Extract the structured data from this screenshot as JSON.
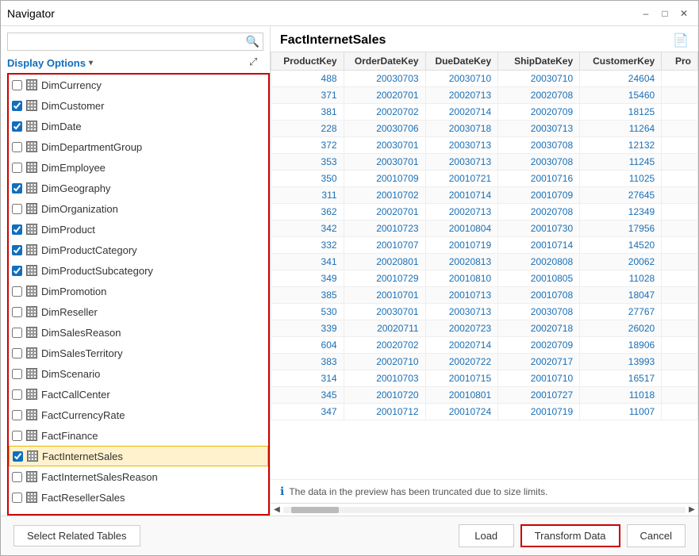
{
  "window": {
    "title": "Navigator",
    "minimize_label": "–",
    "maximize_label": "□",
    "close_label": "✕"
  },
  "left_panel": {
    "search_placeholder": "",
    "display_options_label": "Display Options",
    "display_options_arrow": "▾",
    "expand_label": "⤢",
    "tables": [
      {
        "id": "DimCurrency",
        "name": "DimCurrency",
        "checked": false,
        "selected": false
      },
      {
        "id": "DimCustomer",
        "name": "DimCustomer",
        "checked": true,
        "selected": false
      },
      {
        "id": "DimDate",
        "name": "DimDate",
        "checked": true,
        "selected": false
      },
      {
        "id": "DimDepartmentGroup",
        "name": "DimDepartmentGroup",
        "checked": false,
        "selected": false
      },
      {
        "id": "DimEmployee",
        "name": "DimEmployee",
        "checked": false,
        "selected": false
      },
      {
        "id": "DimGeography",
        "name": "DimGeography",
        "checked": true,
        "selected": false
      },
      {
        "id": "DimOrganization",
        "name": "DimOrganization",
        "checked": false,
        "selected": false
      },
      {
        "id": "DimProduct",
        "name": "DimProduct",
        "checked": true,
        "selected": false
      },
      {
        "id": "DimProductCategory",
        "name": "DimProductCategory",
        "checked": true,
        "selected": false
      },
      {
        "id": "DimProductSubcategory",
        "name": "DimProductSubcategory",
        "checked": true,
        "selected": false
      },
      {
        "id": "DimPromotion",
        "name": "DimPromotion",
        "checked": false,
        "selected": false
      },
      {
        "id": "DimReseller",
        "name": "DimReseller",
        "checked": false,
        "selected": false
      },
      {
        "id": "DimSalesReason",
        "name": "DimSalesReason",
        "checked": false,
        "selected": false
      },
      {
        "id": "DimSalesTerritory",
        "name": "DimSalesTerritory",
        "checked": false,
        "selected": false
      },
      {
        "id": "DimScenario",
        "name": "DimScenario",
        "checked": false,
        "selected": false
      },
      {
        "id": "FactCallCenter",
        "name": "FactCallCenter",
        "checked": false,
        "selected": false
      },
      {
        "id": "FactCurrencyRate",
        "name": "FactCurrencyRate",
        "checked": false,
        "selected": false
      },
      {
        "id": "FactFinance",
        "name": "FactFinance",
        "checked": false,
        "selected": false
      },
      {
        "id": "FactInternetSales",
        "name": "FactInternetSales",
        "checked": true,
        "selected": true
      },
      {
        "id": "FactInternetSalesReason",
        "name": "FactInternetSalesReason",
        "checked": false,
        "selected": false
      },
      {
        "id": "FactResellerSales",
        "name": "FactResellerSales",
        "checked": false,
        "selected": false
      }
    ]
  },
  "right_panel": {
    "preview_title": "FactInternetSales",
    "export_icon": "📄",
    "columns": [
      "ProductKey",
      "OrderDateKey",
      "DueDateKey",
      "ShipDateKey",
      "CustomerKey",
      "Pro"
    ],
    "rows": [
      [
        "488",
        "20030703",
        "20030710",
        "20030710",
        "24604",
        ""
      ],
      [
        "371",
        "20020701",
        "20020713",
        "20020708",
        "15460",
        ""
      ],
      [
        "381",
        "20020702",
        "20020714",
        "20020709",
        "18125",
        ""
      ],
      [
        "228",
        "20030706",
        "20030718",
        "20030713",
        "11264",
        ""
      ],
      [
        "372",
        "20030701",
        "20030713",
        "20030708",
        "12132",
        ""
      ],
      [
        "353",
        "20030701",
        "20030713",
        "20030708",
        "11245",
        ""
      ],
      [
        "350",
        "20010709",
        "20010721",
        "20010716",
        "11025",
        ""
      ],
      [
        "311",
        "20010702",
        "20010714",
        "20010709",
        "27645",
        ""
      ],
      [
        "362",
        "20020701",
        "20020713",
        "20020708",
        "12349",
        ""
      ],
      [
        "342",
        "20010723",
        "20010804",
        "20010730",
        "17956",
        ""
      ],
      [
        "332",
        "20010707",
        "20010719",
        "20010714",
        "14520",
        ""
      ],
      [
        "341",
        "20020801",
        "20020813",
        "20020808",
        "20062",
        ""
      ],
      [
        "349",
        "20010729",
        "20010810",
        "20010805",
        "11028",
        ""
      ],
      [
        "385",
        "20010701",
        "20010713",
        "20010708",
        "18047",
        ""
      ],
      [
        "530",
        "20030701",
        "20030713",
        "20030708",
        "27767",
        ""
      ],
      [
        "339",
        "20020711",
        "20020723",
        "20020718",
        "26020",
        ""
      ],
      [
        "604",
        "20020702",
        "20020714",
        "20020709",
        "18906",
        ""
      ],
      [
        "383",
        "20020710",
        "20020722",
        "20020717",
        "13993",
        ""
      ],
      [
        "314",
        "20010703",
        "20010715",
        "20010710",
        "16517",
        ""
      ],
      [
        "345",
        "20010720",
        "20010801",
        "20010727",
        "11018",
        ""
      ],
      [
        "347",
        "20010712",
        "20010724",
        "20010719",
        "11007",
        ""
      ]
    ],
    "truncate_notice": "The data in the preview has been truncated due to size limits."
  },
  "bottom_bar": {
    "select_related_label": "Select Related Tables",
    "load_label": "Load",
    "transform_label": "Transform Data",
    "cancel_label": "Cancel"
  }
}
